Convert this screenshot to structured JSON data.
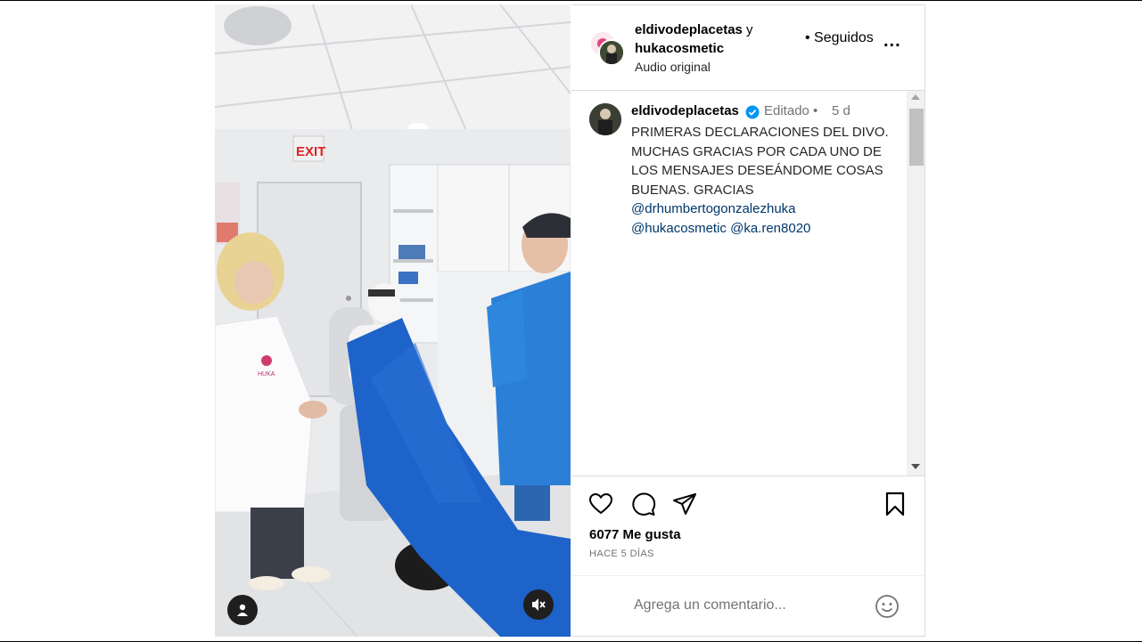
{
  "header": {
    "user1": "eldivodeplacetas",
    "joiner": " y",
    "user2": "hukacosmetic",
    "audio": "Audio original",
    "follow_status": "• Seguidos",
    "more": "..."
  },
  "post": {
    "username": "eldivodeplacetas",
    "edited": "Editado",
    "separator": "•",
    "time": "5 d",
    "caption_lines": [
      "PRIMERAS DECLARACIONES DEL DIVO.",
      "MUCHAS GRACIAS POR CADA UNO DE",
      "LOS MENSAJES DESEÁNDOME COSAS",
      "BUENAS. GRACIAS"
    ],
    "mentions": [
      "@drhumbertogonzalezhuka",
      "@hukacosmetic",
      "@ka.ren8020"
    ]
  },
  "likes": "6077 Me gusta",
  "posted_ago": "HACE 5 DÍAS",
  "comment": {
    "placeholder": "Agrega un comentario..."
  },
  "media": {
    "exit_sign": "EXIT",
    "logo_text": "HUKA"
  },
  "icons": {
    "like": "heart-icon",
    "comment": "comment-icon",
    "share": "send-icon",
    "save": "bookmark-icon",
    "emoji": "emoji-icon",
    "mute": "muted-speaker-icon",
    "tag": "user-tag-icon"
  },
  "colors": {
    "verified": "#0095f6",
    "mention": "#00376b",
    "drape": "#1d63c9"
  }
}
